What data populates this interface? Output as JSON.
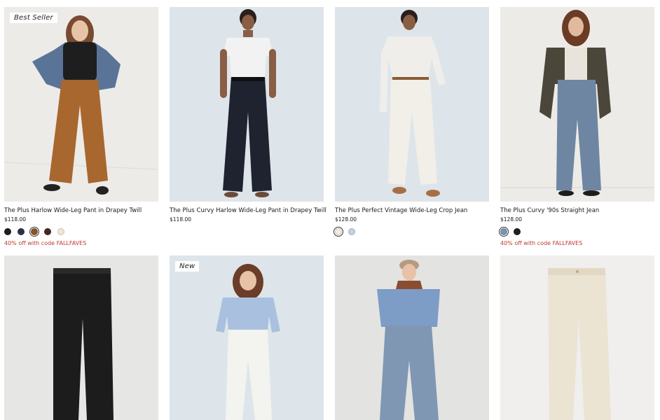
{
  "products": [
    {
      "badge": "Best Seller",
      "name": "The Plus Harlow Wide-Leg Pant in Drapey Twill",
      "price": "$118.00",
      "swatches": [
        "#1d1d22",
        "#2a3148",
        "#8a5528",
        "#4a2622",
        "#efe6d2"
      ],
      "promo": "40% off with code FALLFAVES",
      "bg": "#ecebe8"
    },
    {
      "badge": "",
      "name": "The Plus Curvy Harlow Wide-Leg Pant in Drapey Twill",
      "price": "$118.00",
      "swatches": [],
      "promo": "",
      "bg": "#dde5ea"
    },
    {
      "badge": "",
      "name": "The Plus Perfect Vintage Wide-Leg Crop Jean",
      "price": "$128.00",
      "swatches": [
        "#f1ecdf",
        "#c3d2de"
      ],
      "promo": "",
      "bg": "#dde5ea"
    },
    {
      "badge": "",
      "name": "The Plus Curvy '90s Straight Jean",
      "price": "$128.00",
      "swatches": [
        "#7b93b3",
        "#1d1d22"
      ],
      "promo": "40% off with code FALLFAVES",
      "bg": "#ecebe8"
    },
    {
      "badge": "",
      "name": "",
      "price": "",
      "swatches": [],
      "promo": "",
      "bg": "#e6e6e4"
    },
    {
      "badge": "New",
      "name": "",
      "price": "",
      "swatches": [],
      "promo": "",
      "bg": "#dde5ea"
    },
    {
      "badge": "",
      "name": "",
      "price": "",
      "swatches": [],
      "promo": "",
      "bg": "#e3e3e1"
    },
    {
      "badge": "",
      "name": "",
      "price": "",
      "swatches": [],
      "promo": "",
      "bg": "#f0efee"
    }
  ]
}
